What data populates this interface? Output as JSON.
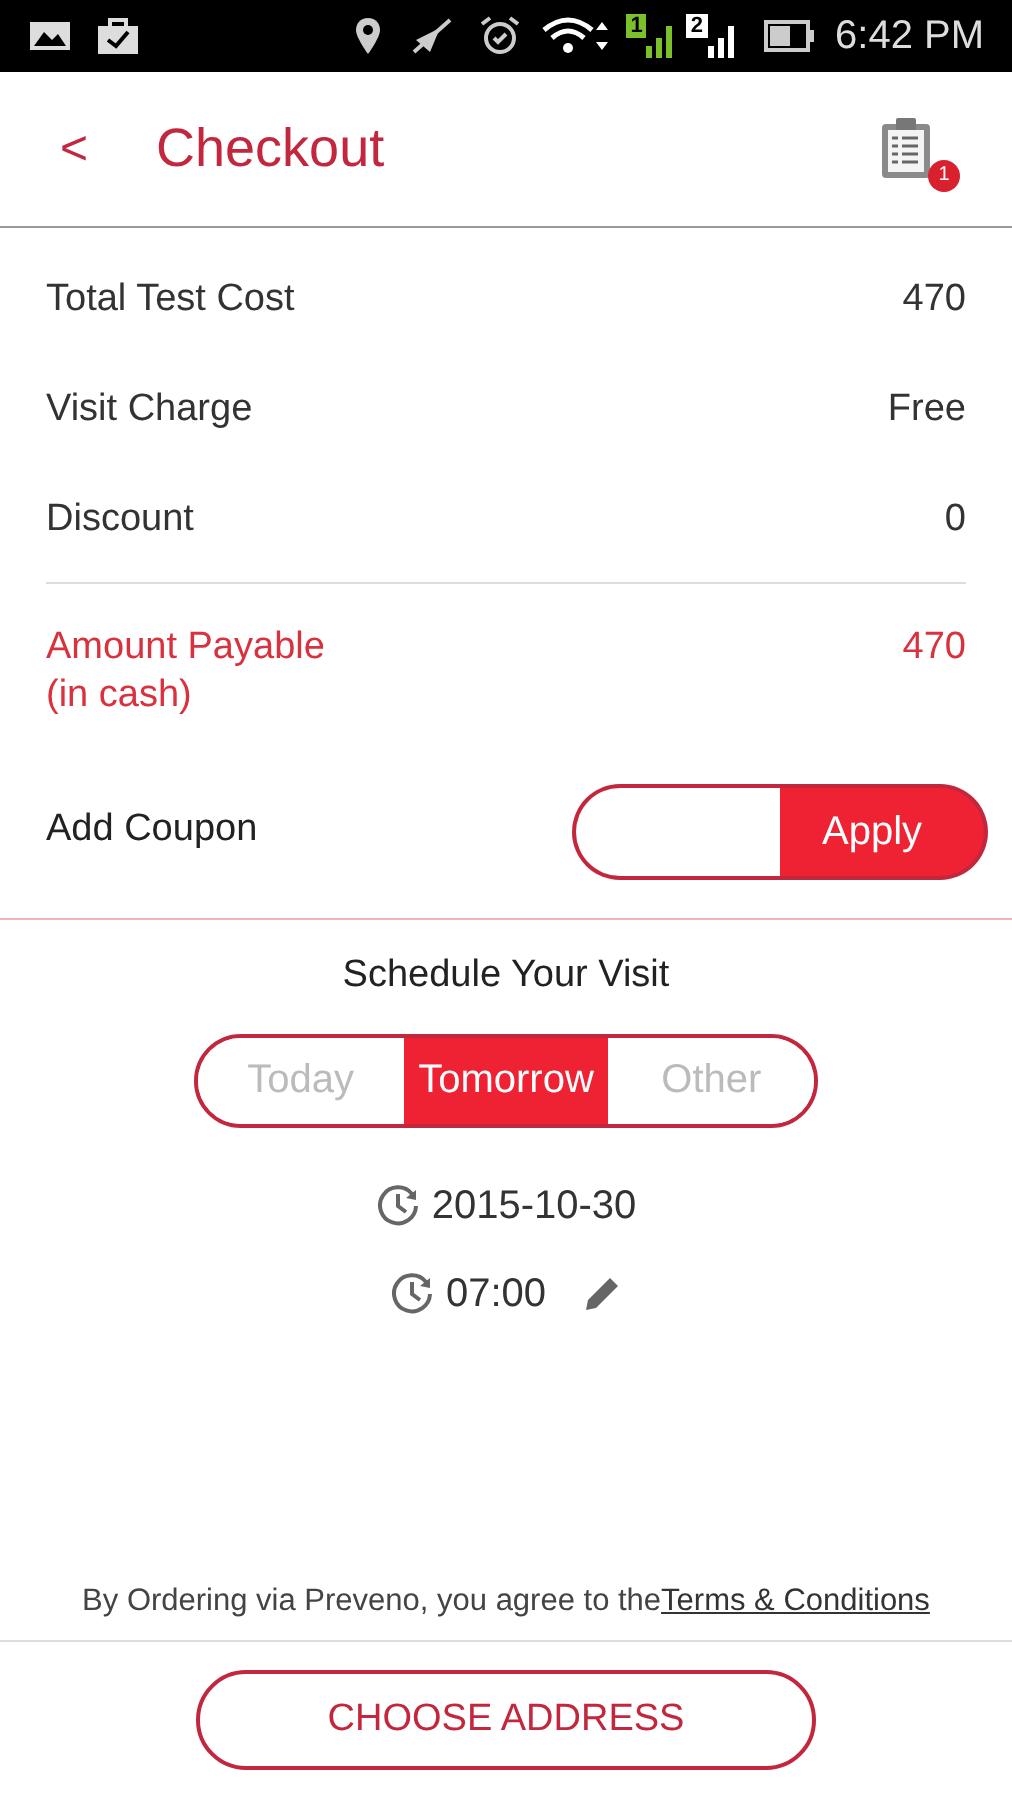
{
  "status_bar": {
    "sim_1": "1",
    "sim_2": "2",
    "time": "6:42 PM"
  },
  "header": {
    "back": "<",
    "title": "Checkout",
    "cart_badge": "1"
  },
  "summary": [
    {
      "label": [
        "Total Test Cost"
      ],
      "value": "470",
      "highlight": false
    },
    {
      "label": [
        "Visit Charge"
      ],
      "value": "Free",
      "highlight": false
    },
    {
      "label": [
        "Discount"
      ],
      "value": "0",
      "highlight": false
    },
    {
      "label": [
        "Amount Payable",
        "(in cash)"
      ],
      "value": "470",
      "highlight": true
    }
  ],
  "coupon": {
    "label": "Add Coupon",
    "button": "Apply"
  },
  "schedule": {
    "title": "Schedule Your Visit",
    "days": [
      {
        "label": "Today",
        "selected": false
      },
      {
        "label": "Tomorrow",
        "selected": true
      },
      {
        "label": "Other",
        "selected": false
      }
    ],
    "date": "2015-10-30",
    "time": "07:00"
  },
  "terms": {
    "text": "By Ordering via Preveno, you agree to the",
    "link": "Terms & Conditions"
  },
  "action": "CHOOSE ADDRESS"
}
